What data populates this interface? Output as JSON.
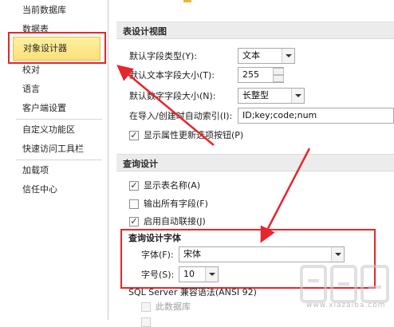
{
  "sidebar": {
    "items": [
      {
        "label": "当前数据库"
      },
      {
        "label": "数据表"
      },
      {
        "label": "对象设计器",
        "selected": true
      },
      {
        "label": "校对"
      },
      {
        "label": "语言"
      },
      {
        "label": "客户端设置"
      },
      {
        "label": "自定义功能区"
      },
      {
        "label": "快速访问工具栏"
      },
      {
        "label": "加载项"
      },
      {
        "label": "信任中心"
      }
    ]
  },
  "table_design": {
    "header": "表设计视图",
    "default_field_type": {
      "label": "默认字段类型(Y):",
      "value": "文本"
    },
    "default_text_size": {
      "label": "默认文本字段大小(T):",
      "value": "255"
    },
    "default_number_size": {
      "label": "默认数字字段大小(N):",
      "value": "长整型"
    },
    "autoindex": {
      "label": "在导入/创建时自动索引(I):",
      "value": "ID;key;code;num"
    },
    "show_property_update": {
      "label": "显示属性更新选项按钮(P)",
      "checked": true
    }
  },
  "query_design": {
    "header": "查询设计",
    "show_table_names": {
      "label": "显示表名称(A)",
      "checked": true
    },
    "output_all_fields": {
      "label": "输出所有字段(F)",
      "checked": false
    },
    "enable_autojoin": {
      "label": "启用自动联接(J)",
      "checked": true
    },
    "font_group_title": "查询设计字体",
    "font": {
      "label": "字体(F):",
      "value": "宋体"
    },
    "size": {
      "label": "字号(S):",
      "value": "10"
    },
    "sql_compat": {
      "label": "SQL Server 兼容语法(ANSI 92)"
    },
    "this_database": {
      "label": "此数据库"
    }
  },
  "watermark": {
    "text": "下载吧",
    "sub": "www.xiazaiba.com"
  },
  "colors": {
    "highlight": "#e8252a",
    "selected_bg": "#fde07a"
  }
}
